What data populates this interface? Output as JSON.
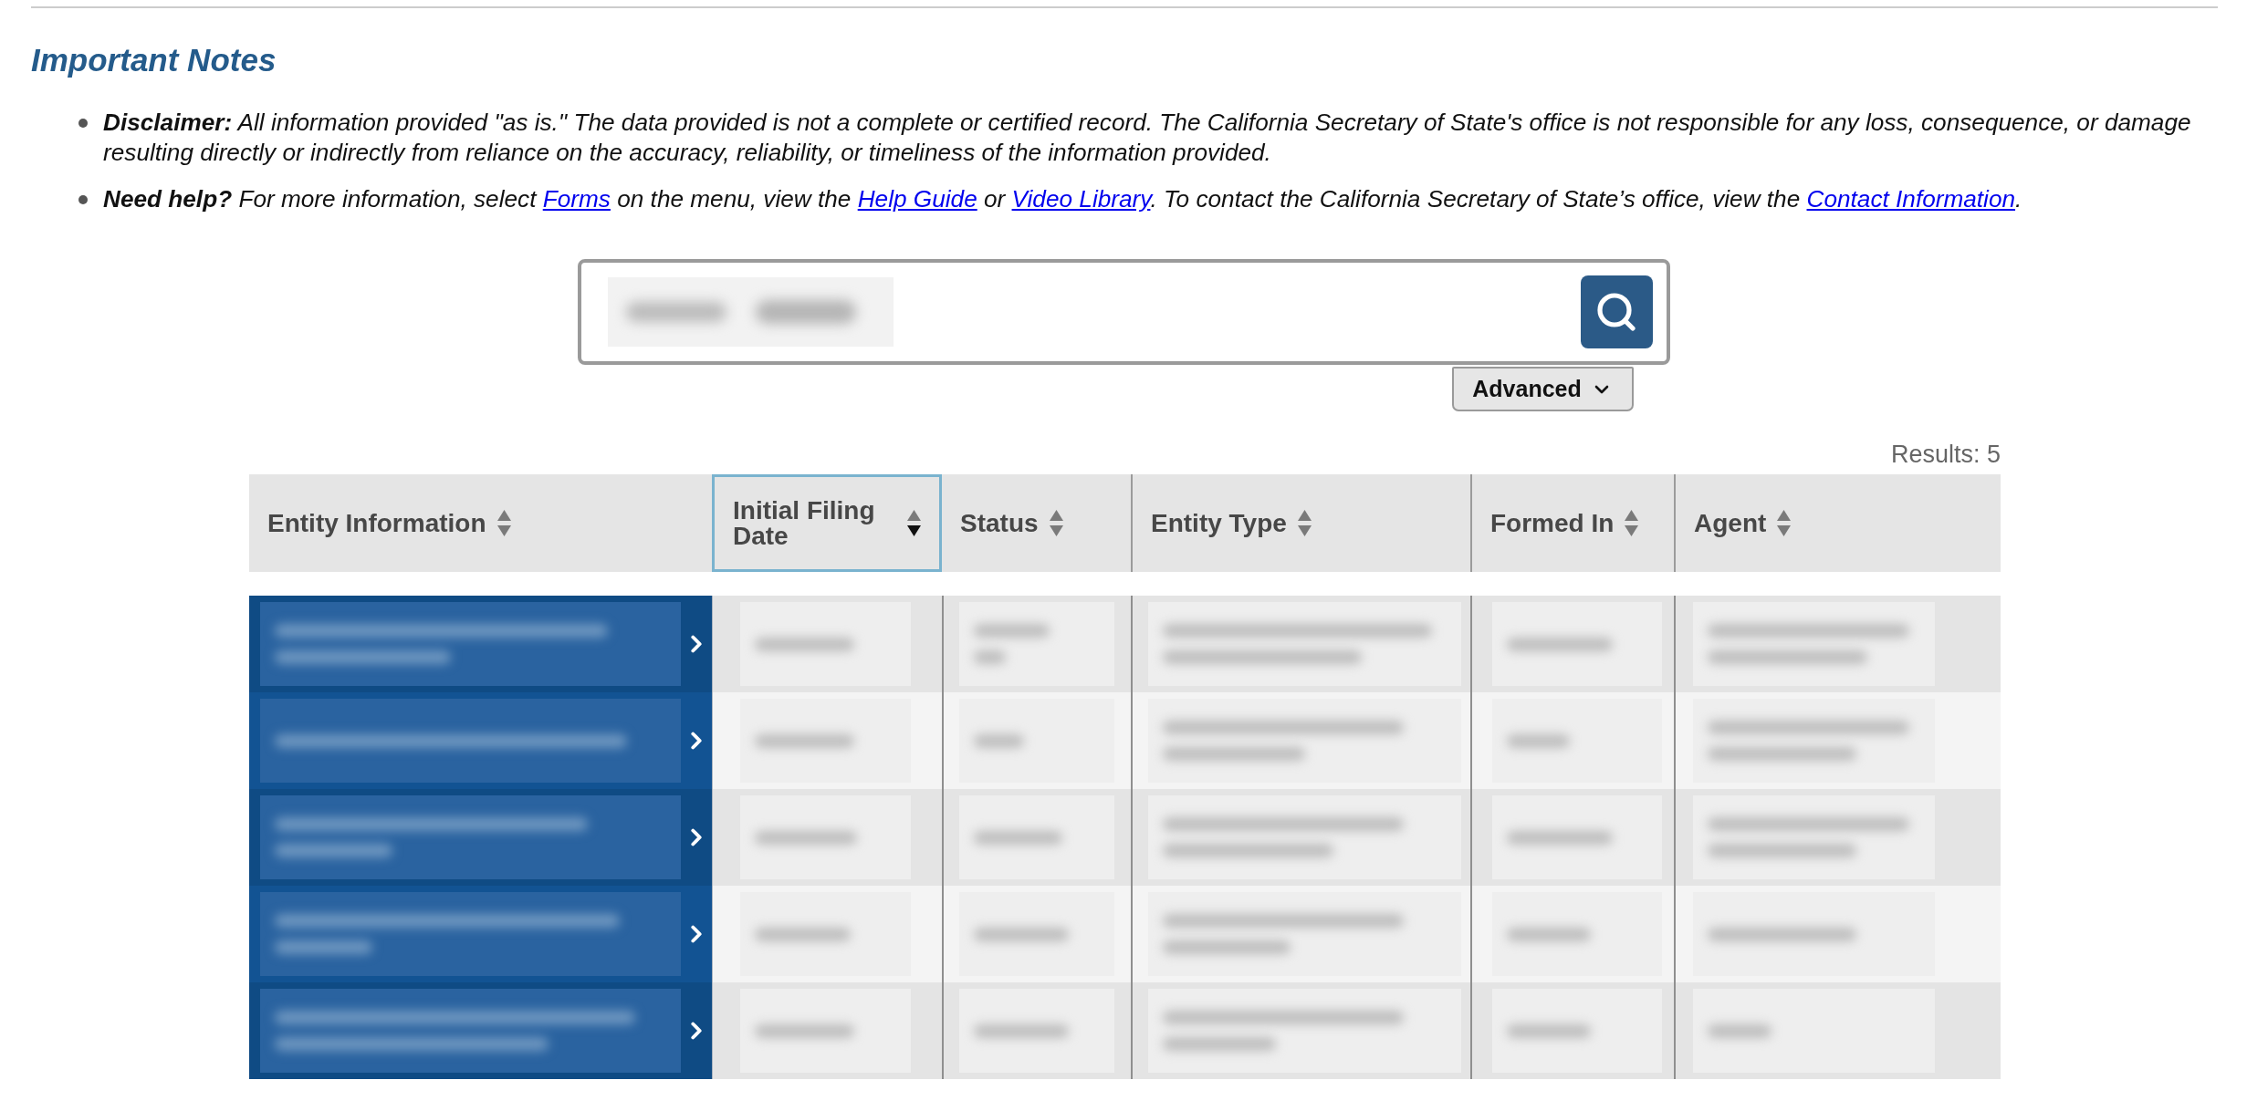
{
  "notes": {
    "title": "Important Notes",
    "items": [
      {
        "parts": [
          {
            "kind": "text",
            "text": "**Disclaimer:** All information provided \"as is.\" The data provided is not a complete or certified record. The California Secretary of State's office is not responsible for any loss, consequence, or damage resulting directly or indirectly from reliance on the accuracy, reliability, or timeliness of the information provided."
          }
        ]
      },
      {
        "parts": [
          {
            "kind": "text",
            "text": "**Need help?** For more information, select "
          },
          {
            "kind": "link",
            "text": "Forms"
          },
          {
            "kind": "text",
            "text": " on the menu, view the "
          },
          {
            "kind": "link",
            "text": "Help Guide"
          },
          {
            "kind": "text",
            "text": " or "
          },
          {
            "kind": "link",
            "text": "Video Library"
          },
          {
            "kind": "text",
            "text": ". To contact the California Secretary of State’s office, view the "
          },
          {
            "kind": "link",
            "text": "Contact Information"
          },
          {
            "kind": "text",
            "text": "."
          }
        ]
      }
    ]
  },
  "search": {
    "value_redacted": true,
    "advanced_button": "Advanced"
  },
  "results": "Results: 5",
  "table": {
    "columns": [
      {
        "label": "Entity Information",
        "sort_descending": false,
        "focused": false
      },
      {
        "label": "Initial Filing Date",
        "sort_descending": true,
        "focused": true
      },
      {
        "label": "Status",
        "sort_descending": false,
        "focused": false
      },
      {
        "label": "Entity Type",
        "sort_descending": false,
        "focused": false
      },
      {
        "label": "Formed In",
        "sort_descending": false,
        "focused": false
      },
      {
        "label": "Agent",
        "sort_descending": false,
        "focused": false
      }
    ],
    "rows": [
      {
        "kind": "redacted"
      },
      {
        "kind": "redacted"
      },
      {
        "kind": "redacted"
      },
      {
        "kind": "redacted"
      },
      {
        "kind": "redacted"
      }
    ]
  }
}
